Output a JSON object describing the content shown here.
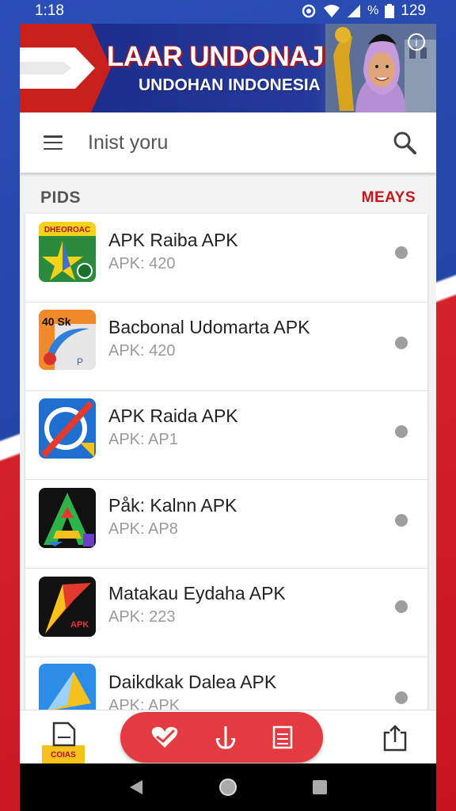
{
  "status_bar": {
    "time": "1:18",
    "battery_percent": "%",
    "battery": "129"
  },
  "banner": {
    "title": "LAAR UNDONAJIA",
    "subtitle": "UNDOHAN INDONESIA",
    "colors": {
      "red": "#c7201d",
      "blue": "#243a9c"
    }
  },
  "search": {
    "placeholder": "Inist yoru"
  },
  "section": {
    "left_label": "PIDS",
    "right_label": "MEAYS"
  },
  "apps": [
    {
      "name": "APK Raiba APK",
      "sub": "APK: 420",
      "icon": "star-apk-icon",
      "icon_text": "DHEOROAC"
    },
    {
      "name": "Bacbonal Udomarta APK",
      "sub": "APK: 420",
      "icon": "swoosh-apk-icon",
      "icon_text": "40 Sk"
    },
    {
      "name": "APK Raida APK",
      "sub": "APK: AP1",
      "icon": "blocked-circle-apk-icon",
      "icon_text": ""
    },
    {
      "name": "Påk: Kalnn APK",
      "sub": "APK: AP8",
      "icon": "triangle-a-apk-icon",
      "icon_text": ""
    },
    {
      "name": "Matakau Eydaha APK",
      "sub": "APK: 223",
      "icon": "red-arrow-apk-icon",
      "icon_text": "APK"
    },
    {
      "name": "Daikdkak Dalea APK",
      "sub": "APK: APK",
      "icon": "blue-paper-apk-icon",
      "icon_text": ""
    }
  ],
  "bottom_nav": {
    "left_badge": "COIAS",
    "pill_color": "#e33b3f",
    "items": [
      "document-icon",
      "heart-icon",
      "anchor-icon",
      "list-icon",
      "share-icon"
    ]
  },
  "system_nav": [
    "back-icon",
    "home-icon",
    "recents-icon"
  ]
}
